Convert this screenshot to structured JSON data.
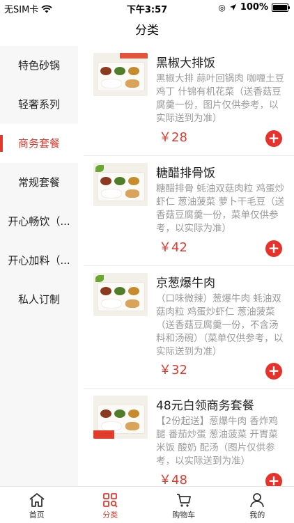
{
  "status_bar": {
    "carrier": "无SIM卡",
    "time": "下午3:57",
    "battery": "100%"
  },
  "nav": {
    "title": "分类"
  },
  "sidebar": {
    "items": [
      {
        "label": "特色砂锅"
      },
      {
        "label": "轻奢系列"
      },
      {
        "label": "商务套餐"
      },
      {
        "label": "常规套餐"
      },
      {
        "label": "开心畅饮（..."
      },
      {
        "label": "开心加料（..."
      },
      {
        "label": "私人订制"
      }
    ],
    "active_index": 2
  },
  "products": [
    {
      "title": "黑椒大排饭",
      "desc": "黑椒大排 蒜叶回锅肉 咖喱土豆鸡丁 什锦有机花菜（送香菇豆腐羹一份，图片仅供参考，以实际送到为准）",
      "price": "￥28"
    },
    {
      "title": "糖醋排骨饭",
      "desc": "糖醋排骨 蚝油双菇肉粒 鸡蛋炒虾仁 葱油菠菜 萝卜干毛豆（送香菇豆腐羹一份，菜单仅供参考，以实际为准）",
      "price": "￥42"
    },
    {
      "title": "京葱爆牛肉",
      "desc": "（口味微辣）葱爆牛肉 蚝油双菇肉粒 鸡蛋炒虾仁 葱油菠菜（送香菇豆腐羹一份，不含汤料和汤碗）（菜单仅供参考，以实际送到为准）",
      "price": "￥32"
    },
    {
      "title": "48元白领商务套餐",
      "desc": "【2份起送】葱爆牛肉 香炸鸡腿 番茄炒蛋 葱油菠菜 开胃菜 米饭 酸奶 配汤（图片仅供参考，以实际送到为准）",
      "price": "￥48"
    }
  ],
  "add_symbol": "+",
  "tab_bar": {
    "items": [
      {
        "label": "首页",
        "icon": "home-icon"
      },
      {
        "label": "分类",
        "icon": "category-icon"
      },
      {
        "label": "购物车",
        "icon": "cart-icon"
      },
      {
        "label": "我的",
        "icon": "profile-icon"
      }
    ],
    "active_index": 1
  },
  "colors": {
    "accent": "#e03a2e",
    "sidebar_bg": "#f7f7f7",
    "desc_text": "#9a9a9a"
  }
}
